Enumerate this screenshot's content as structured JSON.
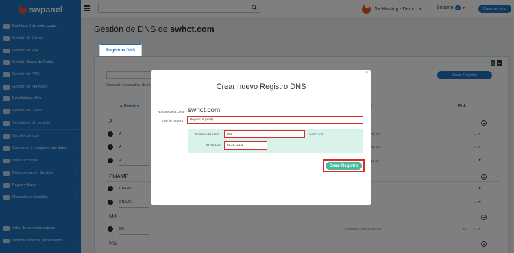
{
  "brand": {
    "logo_text": "swpanel"
  },
  "topbar": {
    "search_placeholder": "",
    "account_name": "Sw Hosting - Demo",
    "support_label": "Soporte",
    "support_badge": "2",
    "crear_servicio_label": "Crear servicio"
  },
  "sidebar": {
    "items": [
      {
        "prefix": "Dashboard de ",
        "bold": "swhct.com",
        "chevron": false
      },
      {
        "label": "Gestión de Correo",
        "chevron": false
      },
      {
        "label": "Gestión de FTP",
        "chevron": false
      },
      {
        "label": "Gestión Bases de Datos",
        "chevron": false
      },
      {
        "label": "Gestión de DNS",
        "chevron": false
      },
      {
        "label": "Gestión de Permisos",
        "chevron": false
      },
      {
        "label": "Estadísticas Web",
        "chevron": false
      },
      {
        "label": "Gestión de Onion",
        "chevron": false
      },
      {
        "label": "Servidores del servicio",
        "chevron": false
      },
      {
        "label": "Uso del servicio",
        "chevron": true
      },
      {
        "label": "Conservar y recuperar mis datos",
        "chevron": true
      },
      {
        "label": "Otras acciones",
        "chevron": true
      },
      {
        "label": "Documentación Servicio",
        "chevron": true
      },
      {
        "label": "Pagos y Bajas",
        "chevron": true
      },
      {
        "label": "Manuales y tutoriales",
        "chevron": true
      }
    ],
    "bottom_items": [
      {
        "label": "Árbol de servicios activos",
        "chevron": false
      },
      {
        "label": "Últimos servicios gestionados",
        "chevron": true
      }
    ]
  },
  "page": {
    "title_prefix": "Gestión de DNS de ",
    "title_domain": "swhct.com",
    "tab_label": "Registros DNS"
  },
  "background_panel": {
    "auto_text": "Creación automática de regi",
    "crear_registro_label": "Crear Registro",
    "col_registro": "Registro",
    "col_ttl_partial": "st",
    "col_prioridad": "Prd.",
    "groups": [
      {
        "name": "A",
        "rows": [
          {
            "type": "A",
            "value": ".125.247",
            "dots": "..."
          },
          {
            "type": "A",
            "value": ".126.193",
            "dots": "..."
          },
          {
            "type": "A",
            "value": ".112.60",
            "dots": "..."
          }
        ]
      },
      {
        "name": "CNAME",
        "rows": [
          {
            "type": "CNAME",
            "value": "",
            "dots": "..."
          },
          {
            "type": "CNAME",
            "value": "",
            "dots": "..."
          }
        ]
      },
      {
        "name": "MX",
        "rows": [
          {
            "type": "MX",
            "value": "us202001121001.dnssw.net",
            "priority": "10",
            "dots": "..."
          }
        ]
      },
      {
        "name": "NS",
        "rows": []
      }
    ]
  },
  "modal": {
    "close": "×",
    "title": "Crear nuevo Registro DNS",
    "zona_label": "Nombre de la Zona",
    "zona_value": "swhct.com",
    "tipo_label": "Tipo de registro",
    "tipo_value": "Registro A (Host)",
    "nombre_label": "Nombre del Host",
    "nombre_value": "ns1",
    "nombre_suffix": ".swhct.com",
    "ip_label": "IP del Host",
    "ip_value": "81.25.112.3",
    "submit_label": "Crear Registro"
  },
  "colors": {
    "brand": "#1e73be",
    "accent_orange": "#e8562a",
    "highlight_red": "#d32f2f",
    "submit_green": "#4cb89a"
  }
}
